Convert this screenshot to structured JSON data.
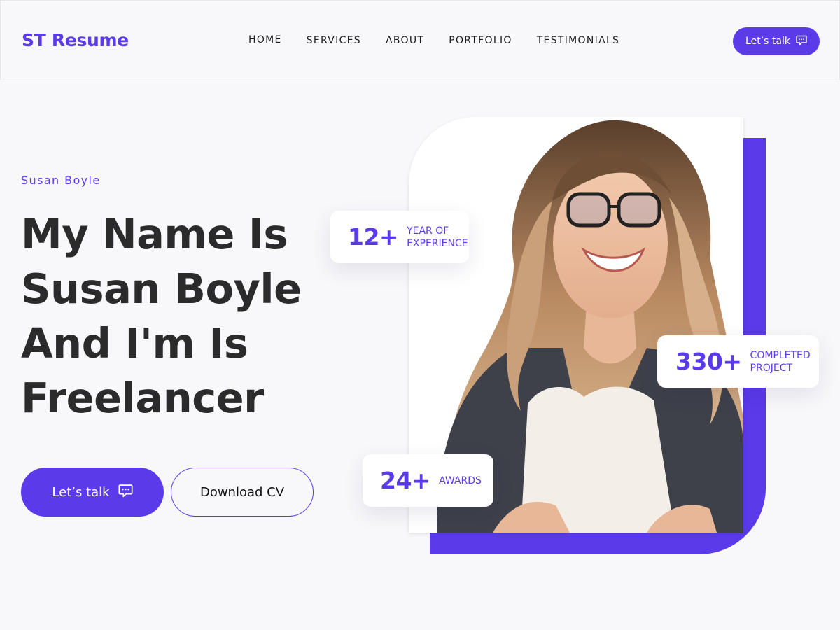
{
  "header": {
    "brand": "ST Resume",
    "nav": [
      {
        "label": "HOME"
      },
      {
        "label": "SERVICES"
      },
      {
        "label": "ABOUT"
      },
      {
        "label": "PORTFOLIO"
      },
      {
        "label": "TESTIMONIALS"
      }
    ],
    "cta_label": "Let’s talk",
    "cta_icon": "chat-icon"
  },
  "hero": {
    "kicker": "Susan Boyle",
    "headline_lines": [
      "My Name Is",
      "Susan Boyle",
      "And I'm Is",
      "Freelancer"
    ],
    "primary_button": "Let’s talk",
    "primary_button_icon": "chat-icon",
    "secondary_button": "Download CV"
  },
  "stats": {
    "experience": {
      "value": "12+",
      "label": "YEAR OF EXPERIENCE"
    },
    "projects": {
      "value": "330+",
      "label": "COMPLETED PROJECT"
    },
    "awards": {
      "value": "24+",
      "label": "AWARDS"
    }
  },
  "colors": {
    "accent": "#5b3aea",
    "text": "#2b2b2b",
    "background": "#f8f8fb"
  }
}
